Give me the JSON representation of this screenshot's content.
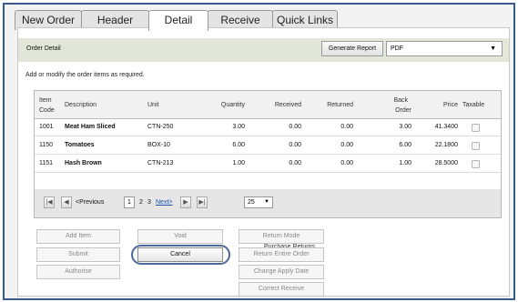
{
  "tabs": [
    {
      "label": "New Order",
      "active": false
    },
    {
      "label": "Header",
      "active": false
    },
    {
      "label": "Detail",
      "active": true
    },
    {
      "label": "Receive",
      "active": false
    },
    {
      "label": "Quick Links",
      "active": false
    }
  ],
  "panel": {
    "title": "Order Detail",
    "generate_label": "Generate Report",
    "format_value": "PDF",
    "hint": "Add or modify the order items as required."
  },
  "columns": {
    "item_code_1": "Item",
    "item_code_2": "Code",
    "description": "Description",
    "unit": "Unit",
    "quantity": "Quantity",
    "received": "Received",
    "returned": "Returned",
    "back_order_1": "Back",
    "back_order_2": "Order",
    "price": "Price",
    "taxable": "Taxable"
  },
  "rows": [
    {
      "code": "1001",
      "description": "Meat Ham Sliced",
      "unit": "CTN-250",
      "quantity": "3.00",
      "received": "0.00",
      "returned": "0.00",
      "back_order": "3.00",
      "price": "41.3400",
      "taxable": false
    },
    {
      "code": "1150",
      "description": "Tomatoes",
      "unit": "BOX-10",
      "quantity": "6.00",
      "received": "0.00",
      "returned": "0.00",
      "back_order": "6.00",
      "price": "22.1800",
      "taxable": false
    },
    {
      "code": "1151",
      "description": "Hash Brown",
      "unit": "CTN-213",
      "quantity": "1.00",
      "received": "0.00",
      "returned": "0.00",
      "back_order": "1.00",
      "price": "28.5000",
      "taxable": false
    }
  ],
  "pager": {
    "previous": "<Previous",
    "current_page": "1",
    "page_2": "2",
    "page_3": "3",
    "next": "Next>",
    "page_size": "25"
  },
  "actions": {
    "add_item": "Add Item",
    "void": "Void",
    "submit": "Submit",
    "cancel": "Cancel",
    "authorise": "Authorise"
  },
  "purchase_returns": {
    "label": "Purchase Returns",
    "return_mode": "Return Mode",
    "return_entire_order": "Return Entire Order",
    "change_apply_date": "Change Apply Date",
    "correct_receive": "Correct Receive"
  }
}
